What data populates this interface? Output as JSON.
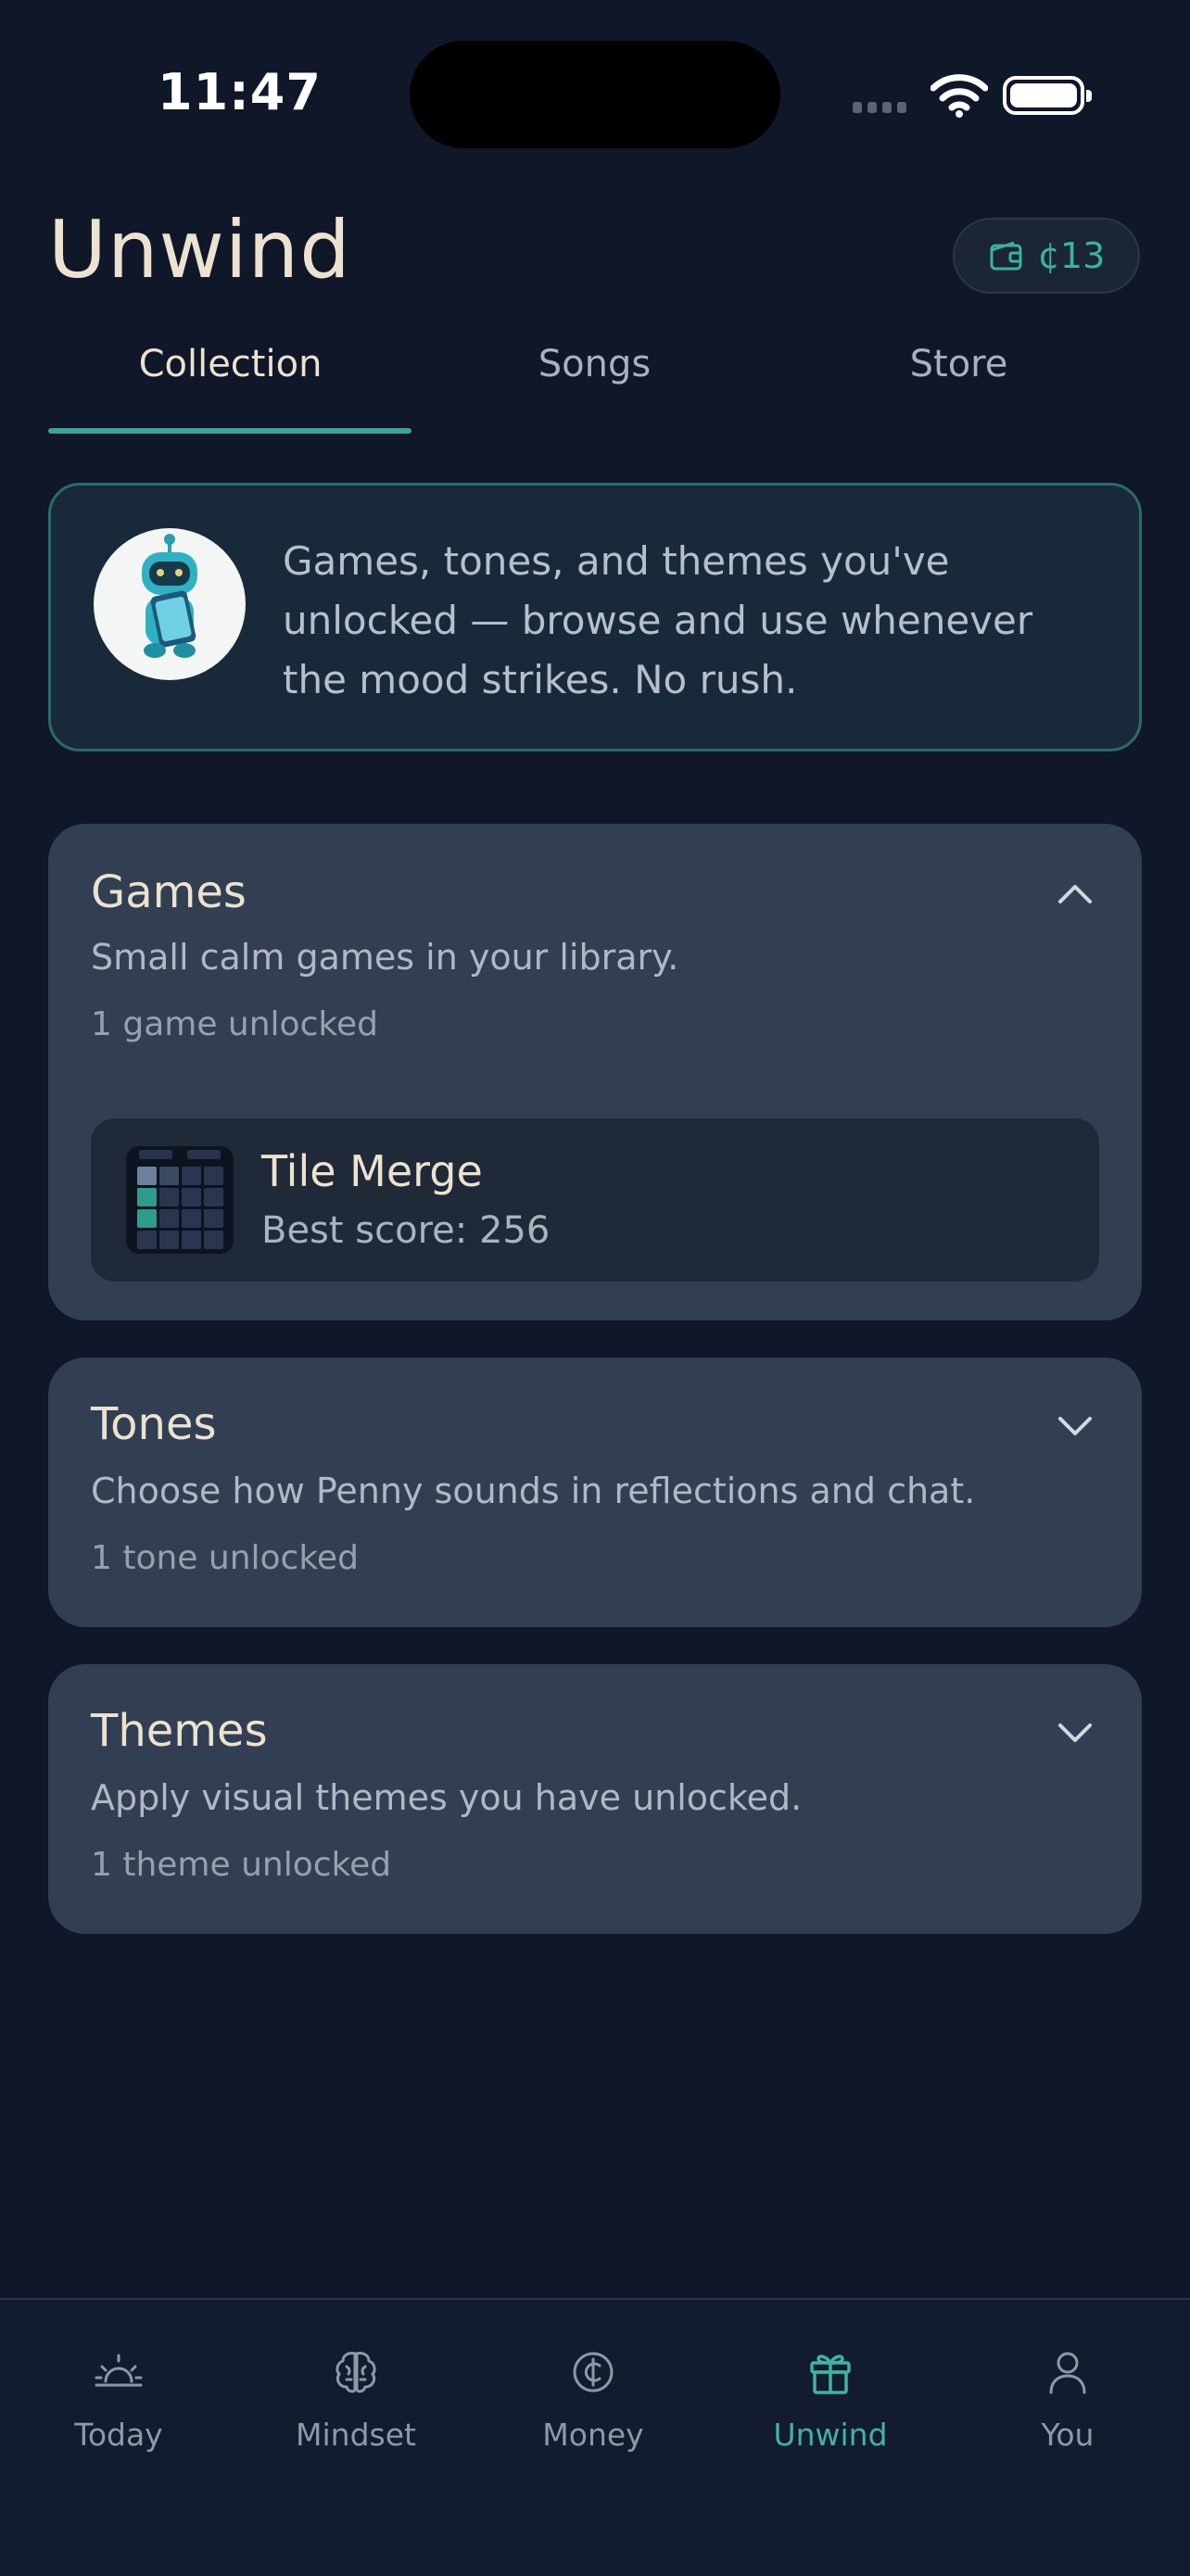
{
  "status": {
    "time": "11:47"
  },
  "header": {
    "title": "Unwind",
    "coins": "¢13"
  },
  "tabs": [
    {
      "label": "Collection"
    },
    {
      "label": "Songs"
    },
    {
      "label": "Store"
    }
  ],
  "intro": {
    "text": "Games, tones, and themes you've unlocked — browse and use whenever the mood strikes. No rush."
  },
  "sections": {
    "games": {
      "title": "Games",
      "subtitle": "Small calm games in your library.",
      "count": "1 game unlocked",
      "items": [
        {
          "name": "Tile Merge",
          "score": "Best score: 256"
        }
      ]
    },
    "tones": {
      "title": "Tones",
      "subtitle": "Choose how Penny sounds in reflections and chat.",
      "count": "1 tone unlocked"
    },
    "themes": {
      "title": "Themes",
      "subtitle": "Apply visual themes you have unlocked.",
      "count": "1 theme unlocked"
    }
  },
  "nav": [
    {
      "label": "Today",
      "icon": "sunrise-icon"
    },
    {
      "label": "Mindset",
      "icon": "brain-icon"
    },
    {
      "label": "Money",
      "icon": "coin-icon"
    },
    {
      "label": "Unwind",
      "icon": "gift-icon"
    },
    {
      "label": "You",
      "icon": "person-icon"
    }
  ],
  "colors": {
    "accent": "#3aa495",
    "background": "#0f1729",
    "card": "#323f52"
  }
}
